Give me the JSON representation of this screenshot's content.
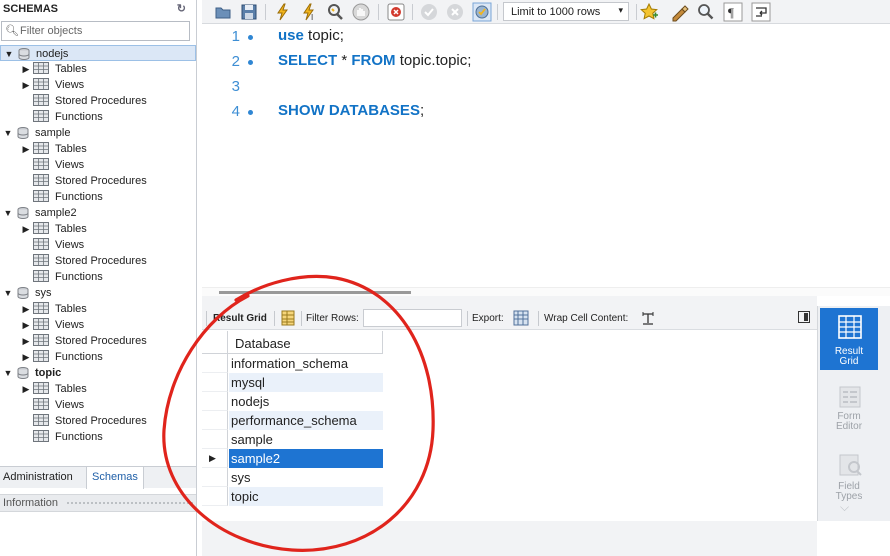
{
  "sidebar": {
    "title": "SCHEMAS",
    "filter_placeholder": "Filter objects",
    "schemas": [
      {
        "name": "nodejs",
        "bold": false,
        "selected": true,
        "children": [
          {
            "label": "Tables",
            "has_arrow": true
          },
          {
            "label": "Views",
            "has_arrow": true
          },
          {
            "label": "Stored Procedures",
            "has_arrow": false
          },
          {
            "label": "Functions",
            "has_arrow": false
          }
        ]
      },
      {
        "name": "sample",
        "bold": false,
        "selected": false,
        "children": [
          {
            "label": "Tables",
            "has_arrow": true
          },
          {
            "label": "Views",
            "has_arrow": false
          },
          {
            "label": "Stored Procedures",
            "has_arrow": false
          },
          {
            "label": "Functions",
            "has_arrow": false
          }
        ]
      },
      {
        "name": "sample2",
        "bold": false,
        "selected": false,
        "children": [
          {
            "label": "Tables",
            "has_arrow": true
          },
          {
            "label": "Views",
            "has_arrow": false
          },
          {
            "label": "Stored Procedures",
            "has_arrow": false
          },
          {
            "label": "Functions",
            "has_arrow": false
          }
        ]
      },
      {
        "name": "sys",
        "bold": false,
        "selected": false,
        "children": [
          {
            "label": "Tables",
            "has_arrow": true
          },
          {
            "label": "Views",
            "has_arrow": true
          },
          {
            "label": "Stored Procedures",
            "has_arrow": true
          },
          {
            "label": "Functions",
            "has_arrow": true
          }
        ]
      },
      {
        "name": "topic",
        "bold": true,
        "selected": false,
        "children": [
          {
            "label": "Tables",
            "has_arrow": true
          },
          {
            "label": "Views",
            "has_arrow": false
          },
          {
            "label": "Stored Procedures",
            "has_arrow": false
          },
          {
            "label": "Functions",
            "has_arrow": false
          }
        ]
      }
    ],
    "tabs": {
      "administration": "Administration",
      "schemas": "Schemas"
    },
    "info_label": "Information"
  },
  "toolbar": {
    "limit_label": "Limit to 1000 rows",
    "icons": [
      "open-folder-icon",
      "save-icon",
      "execute-icon",
      "execute-current-icon",
      "explain-icon",
      "stop-icon",
      "toggle-error-icon",
      "commit-icon",
      "rollback-icon",
      "autocommit-icon",
      "bookmark-icon",
      "beautify-icon",
      "find-icon",
      "invisibles-icon",
      "wrap-icon"
    ]
  },
  "editor": {
    "lines": [
      {
        "num": "1",
        "dot": true,
        "parts": [
          {
            "t": "use",
            "kw": true
          },
          {
            "t": " topic;",
            "kw": false
          }
        ]
      },
      {
        "num": "2",
        "dot": true,
        "parts": [
          {
            "t": "SELECT",
            "kw": true
          },
          {
            "t": " * ",
            "kw": false
          },
          {
            "t": "FROM",
            "kw": true
          },
          {
            "t": " topic.topic;",
            "kw": false
          }
        ]
      },
      {
        "num": "3",
        "dot": false,
        "parts": []
      },
      {
        "num": "4",
        "dot": true,
        "parts": [
          {
            "t": "SHOW DATABASES",
            "kw": true
          },
          {
            "t": ";",
            "kw": false
          }
        ]
      }
    ]
  },
  "result_bar": {
    "result_grid": "Result Grid",
    "filter_rows": "Filter Rows:",
    "export": "Export:",
    "wrap": "Wrap Cell Content:"
  },
  "grid": {
    "column": "Database",
    "rows": [
      "information_schema",
      "mysql",
      "nodejs",
      "performance_schema",
      "sample",
      "sample2",
      "sys",
      "topic"
    ],
    "selected_index": 5
  },
  "side_panel": {
    "result_grid": [
      "Result",
      "Grid"
    ],
    "form_editor": [
      "Form",
      "Editor"
    ],
    "field_types": [
      "Field",
      "Types"
    ]
  },
  "colors": {
    "keyword": "#1273c6",
    "selection": "#1e74d2",
    "annotation": "#e0241c"
  }
}
